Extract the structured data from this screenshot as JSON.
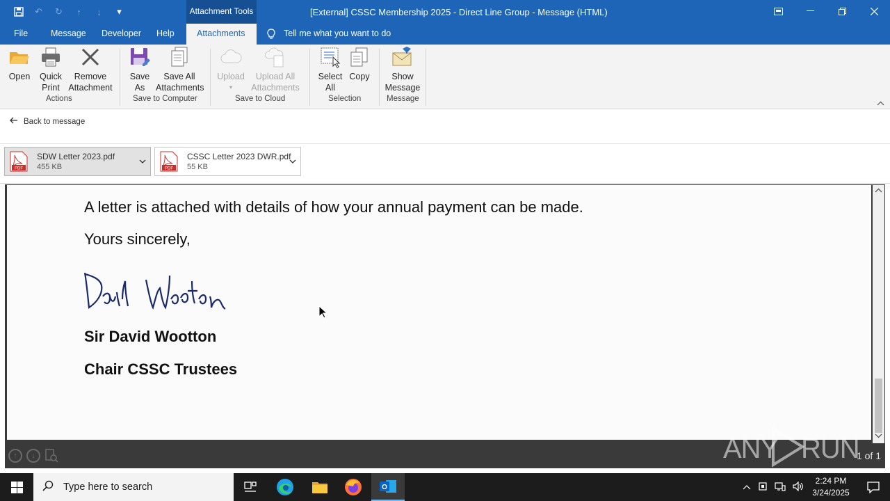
{
  "titlebar": {
    "contextual_tab": "Attachment Tools",
    "window_title": "[External] CSSC Membership 2025 - Direct Line Group  -  Message (HTML)"
  },
  "tabs": [
    {
      "label": "File"
    },
    {
      "label": "Message"
    },
    {
      "label": "Developer"
    },
    {
      "label": "Help"
    },
    {
      "label": "Attachments"
    }
  ],
  "tell_me": "Tell me what you want to do",
  "ribbon": {
    "groups": {
      "actions": "Actions",
      "save_to_computer": "Save to Computer",
      "save_to_cloud": "Save to Cloud",
      "selection": "Selection",
      "message": "Message"
    },
    "open": "Open",
    "quick_print": [
      "Quick",
      "Print"
    ],
    "remove_attachment": [
      "Remove",
      "Attachment"
    ],
    "save_as": [
      "Save",
      "As"
    ],
    "save_all": [
      "Save All",
      "Attachments"
    ],
    "upload": "Upload",
    "upload_all": [
      "Upload All",
      "Attachments"
    ],
    "select_all": [
      "Select",
      "All"
    ],
    "copy": "Copy",
    "show_message": [
      "Show",
      "Message"
    ]
  },
  "back_to_message": "Back to message",
  "attachments": [
    {
      "name": "SDW Letter 2023.pdf",
      "size": "455 KB",
      "selected": true
    },
    {
      "name": "CSSC Letter 2023 DWR.pdf",
      "size": "55 KB",
      "selected": false
    }
  ],
  "document": {
    "line1": "A letter is attached with details of how your annual payment can be made.",
    "closing": "Yours sincerely,",
    "signer": "Sir David Wootton",
    "role": "Chair CSSC Trustees"
  },
  "viewer": {
    "page_count": "1 of 1",
    "scroll_position_fraction": 0.82
  },
  "watermark": "ANY RUN",
  "taskbar": {
    "search_placeholder": "Type here to search",
    "time": "2:24 PM",
    "date": "3/24/2025"
  },
  "colors": {
    "title_blue": "#1e65b8",
    "ribbon_bg": "#f3f3f3",
    "taskbar_bg": "#1c1c1c"
  }
}
